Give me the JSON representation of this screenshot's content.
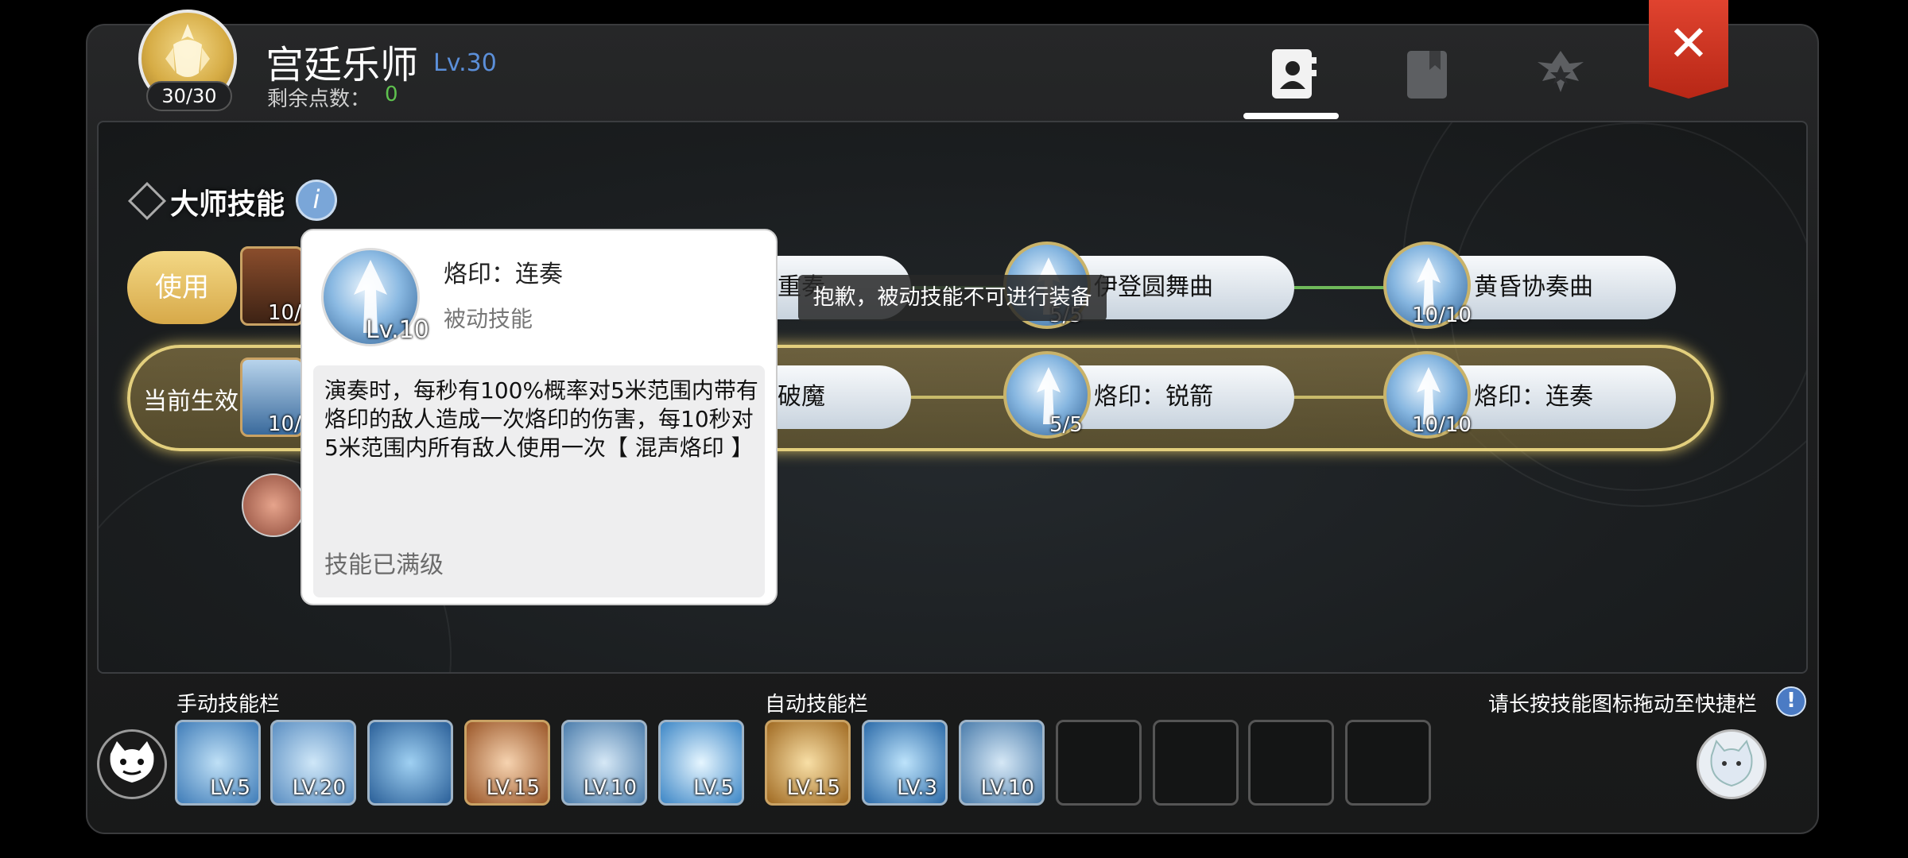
{
  "header": {
    "class_title": "宫廷乐师",
    "level": "Lv.30",
    "points_label": "剩余点数：",
    "points_value": "0",
    "avatar_count": "30/30"
  },
  "tabs": [
    {
      "name": "profile-tab",
      "icon": "profile-book-icon",
      "active": true
    },
    {
      "name": "codex-tab",
      "icon": "bookmark-book-icon",
      "active": false
    },
    {
      "name": "rank-tab",
      "icon": "star-emblem-icon",
      "active": false
    }
  ],
  "master": {
    "title": "大师技能",
    "use_label": "使用",
    "current_label": "当前生效",
    "row1": [
      {
        "name": "重奏",
        "level": "10/",
        "hidden_prefix": true
      },
      {
        "name": "伊登圆舞曲",
        "level": "5/5"
      },
      {
        "name": "黄昏协奏曲",
        "level": "10/10"
      }
    ],
    "row2": [
      {
        "name": "破魔",
        "level": "10/",
        "hidden_prefix": true
      },
      {
        "name": "烙印：锐箭",
        "level": "5/5"
      },
      {
        "name": "烙印：连奏",
        "level": "10/10"
      }
    ]
  },
  "toast": "抱歉，被动技能不可进行装备",
  "popup": {
    "name": "烙印：连奏",
    "type": "被动技能",
    "level": "Lv.10",
    "description": "演奏时，每秒有100%概率对5米范围内带有烙印的敌人造成一次烙印的伤害，每10秒对5米范围内所有敌人使用一次【 混声烙印 】",
    "status": "技能已满级"
  },
  "manual_bar": {
    "label": "手动技能栏",
    "slots": [
      "LV.5",
      "LV.20",
      "",
      "LV.15",
      "LV.10",
      "LV.5"
    ]
  },
  "auto_bar": {
    "label": "自动技能栏",
    "slots": [
      "LV.15",
      "LV.3",
      "LV.10",
      "",
      "",
      "",
      ""
    ]
  },
  "hint": "请长按技能图标拖动至快捷栏",
  "colors": {
    "accent_blue": "#5b8fd9",
    "points_green": "#5ec14e",
    "close_red": "#d13a25",
    "gold": "#e3cf7d"
  }
}
